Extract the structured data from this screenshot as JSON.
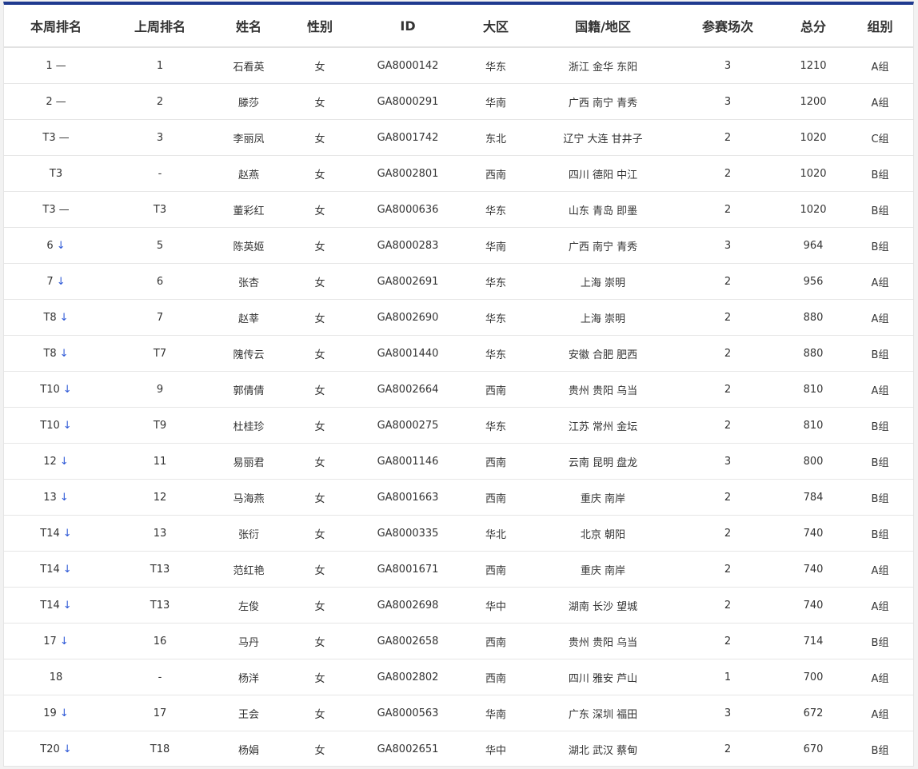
{
  "colors": {
    "accent_bar": "#1f3a8f",
    "down_arrow": "#2c57d6"
  },
  "trend_icons": {
    "flat": "—",
    "down": "↓"
  },
  "columns": [
    "本周排名",
    "上周排名",
    "姓名",
    "性别",
    "ID",
    "大区",
    "国籍/地区",
    "参赛场次",
    "总分",
    "组别"
  ],
  "rows": [
    {
      "rank": "1",
      "trend": "flat",
      "prev": "1",
      "name": "石看英",
      "gender": "女",
      "id": "GA8000142",
      "region": "华东",
      "area": "浙江 金华 东阳",
      "played": "3",
      "score": "1210",
      "group": "A组"
    },
    {
      "rank": "2",
      "trend": "flat",
      "prev": "2",
      "name": "滕莎",
      "gender": "女",
      "id": "GA8000291",
      "region": "华南",
      "area": "广西 南宁 青秀",
      "played": "3",
      "score": "1200",
      "group": "A组"
    },
    {
      "rank": "T3",
      "trend": "flat",
      "prev": "3",
      "name": "李丽凤",
      "gender": "女",
      "id": "GA8001742",
      "region": "东北",
      "area": "辽宁 大连 甘井子",
      "played": "2",
      "score": "1020",
      "group": "C组"
    },
    {
      "rank": "T3",
      "trend": "",
      "prev": "-",
      "name": "赵燕",
      "gender": "女",
      "id": "GA8002801",
      "region": "西南",
      "area": "四川 德阳 中江",
      "played": "2",
      "score": "1020",
      "group": "B组"
    },
    {
      "rank": "T3",
      "trend": "flat",
      "prev": "T3",
      "name": "董彩红",
      "gender": "女",
      "id": "GA8000636",
      "region": "华东",
      "area": "山东 青岛 即墨",
      "played": "2",
      "score": "1020",
      "group": "B组"
    },
    {
      "rank": "6",
      "trend": "down",
      "prev": "5",
      "name": "陈英姬",
      "gender": "女",
      "id": "GA8000283",
      "region": "华南",
      "area": "广西 南宁 青秀",
      "played": "3",
      "score": "964",
      "group": "B组"
    },
    {
      "rank": "7",
      "trend": "down",
      "prev": "6",
      "name": "张杏",
      "gender": "女",
      "id": "GA8002691",
      "region": "华东",
      "area": "上海 崇明",
      "played": "2",
      "score": "956",
      "group": "A组"
    },
    {
      "rank": "T8",
      "trend": "down",
      "prev": "7",
      "name": "赵莘",
      "gender": "女",
      "id": "GA8002690",
      "region": "华东",
      "area": "上海 崇明",
      "played": "2",
      "score": "880",
      "group": "A组"
    },
    {
      "rank": "T8",
      "trend": "down",
      "prev": "T7",
      "name": "隗传云",
      "gender": "女",
      "id": "GA8001440",
      "region": "华东",
      "area": "安徽 合肥 肥西",
      "played": "2",
      "score": "880",
      "group": "B组"
    },
    {
      "rank": "T10",
      "trend": "down",
      "prev": "9",
      "name": "郭倩倩",
      "gender": "女",
      "id": "GA8002664",
      "region": "西南",
      "area": "贵州 贵阳 乌当",
      "played": "2",
      "score": "810",
      "group": "A组"
    },
    {
      "rank": "T10",
      "trend": "down",
      "prev": "T9",
      "name": "杜桂珍",
      "gender": "女",
      "id": "GA8000275",
      "region": "华东",
      "area": "江苏 常州 金坛",
      "played": "2",
      "score": "810",
      "group": "B组"
    },
    {
      "rank": "12",
      "trend": "down",
      "prev": "11",
      "name": "易丽君",
      "gender": "女",
      "id": "GA8001146",
      "region": "西南",
      "area": "云南 昆明 盘龙",
      "played": "3",
      "score": "800",
      "group": "B组"
    },
    {
      "rank": "13",
      "trend": "down",
      "prev": "12",
      "name": "马海燕",
      "gender": "女",
      "id": "GA8001663",
      "region": "西南",
      "area": "重庆 南岸",
      "played": "2",
      "score": "784",
      "group": "B组"
    },
    {
      "rank": "T14",
      "trend": "down",
      "prev": "13",
      "name": "张衍",
      "gender": "女",
      "id": "GA8000335",
      "region": "华北",
      "area": "北京 朝阳",
      "played": "2",
      "score": "740",
      "group": "B组"
    },
    {
      "rank": "T14",
      "trend": "down",
      "prev": "T13",
      "name": "范红艳",
      "gender": "女",
      "id": "GA8001671",
      "region": "西南",
      "area": "重庆 南岸",
      "played": "2",
      "score": "740",
      "group": "A组"
    },
    {
      "rank": "T14",
      "trend": "down",
      "prev": "T13",
      "name": "左俊",
      "gender": "女",
      "id": "GA8002698",
      "region": "华中",
      "area": "湖南 长沙 望城",
      "played": "2",
      "score": "740",
      "group": "A组"
    },
    {
      "rank": "17",
      "trend": "down",
      "prev": "16",
      "name": "马丹",
      "gender": "女",
      "id": "GA8002658",
      "region": "西南",
      "area": "贵州 贵阳 乌当",
      "played": "2",
      "score": "714",
      "group": "B组"
    },
    {
      "rank": "18",
      "trend": "",
      "prev": "-",
      "name": "杨洋",
      "gender": "女",
      "id": "GA8002802",
      "region": "西南",
      "area": "四川 雅安 芦山",
      "played": "1",
      "score": "700",
      "group": "A组"
    },
    {
      "rank": "19",
      "trend": "down",
      "prev": "17",
      "name": "王会",
      "gender": "女",
      "id": "GA8000563",
      "region": "华南",
      "area": "广东 深圳 福田",
      "played": "3",
      "score": "672",
      "group": "A组"
    },
    {
      "rank": "T20",
      "trend": "down",
      "prev": "T18",
      "name": "杨娟",
      "gender": "女",
      "id": "GA8002651",
      "region": "华中",
      "area": "湖北 武汉 蔡甸",
      "played": "2",
      "score": "670",
      "group": "B组"
    }
  ]
}
